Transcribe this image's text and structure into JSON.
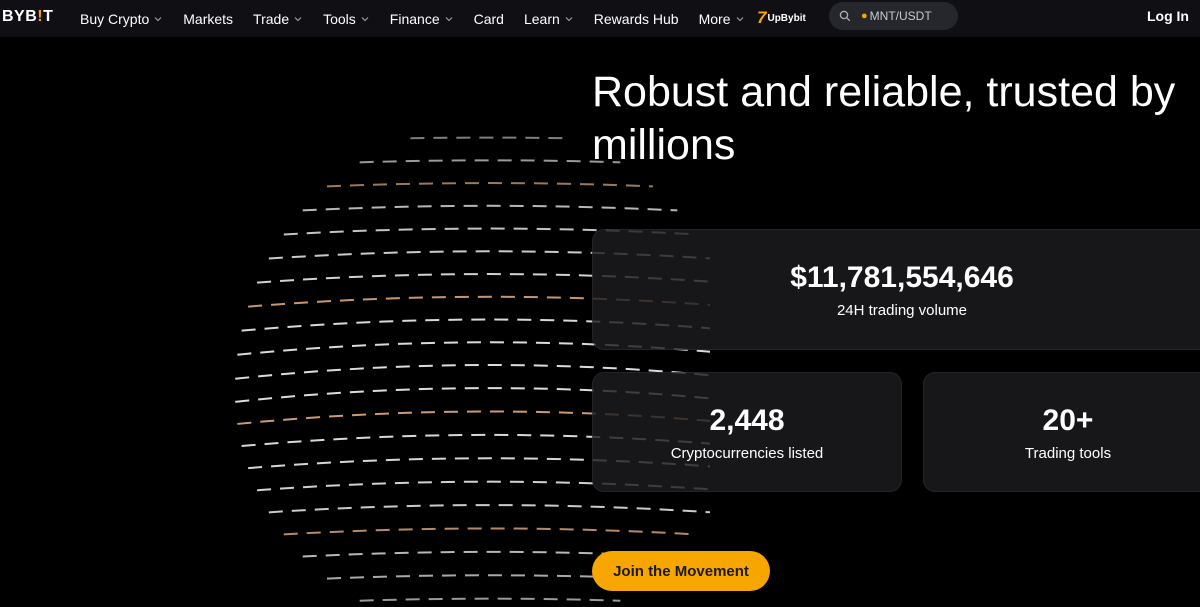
{
  "brand": {
    "logo_text_a": "BYB",
    "logo_text_b": "!",
    "logo_text_c": "T",
    "accent": "#f7a600"
  },
  "nav": {
    "items": [
      {
        "label": "Buy Crypto",
        "dropdown": true
      },
      {
        "label": "Markets",
        "dropdown": false
      },
      {
        "label": "Trade",
        "dropdown": true
      },
      {
        "label": "Tools",
        "dropdown": true
      },
      {
        "label": "Finance",
        "dropdown": true
      },
      {
        "label": "Card",
        "dropdown": false
      },
      {
        "label": "Learn",
        "dropdown": true
      },
      {
        "label": "Rewards Hub",
        "dropdown": false
      },
      {
        "label": "More",
        "dropdown": true
      }
    ],
    "promo_seven": "7",
    "promo_label": "UpBybit",
    "search_value": "MNT/USDT",
    "login_label": "Log In"
  },
  "hero": {
    "headline": "Robust and reliable, trusted by millions"
  },
  "stats": {
    "volume": {
      "value": "$11,781,554,646",
      "label": "24H trading volume"
    },
    "cryptos": {
      "value": "2,448",
      "label": "Cryptocurrencies listed"
    },
    "tools": {
      "value": "20+",
      "label": "Trading tools"
    }
  },
  "cta": {
    "label": "Join the Movement"
  }
}
